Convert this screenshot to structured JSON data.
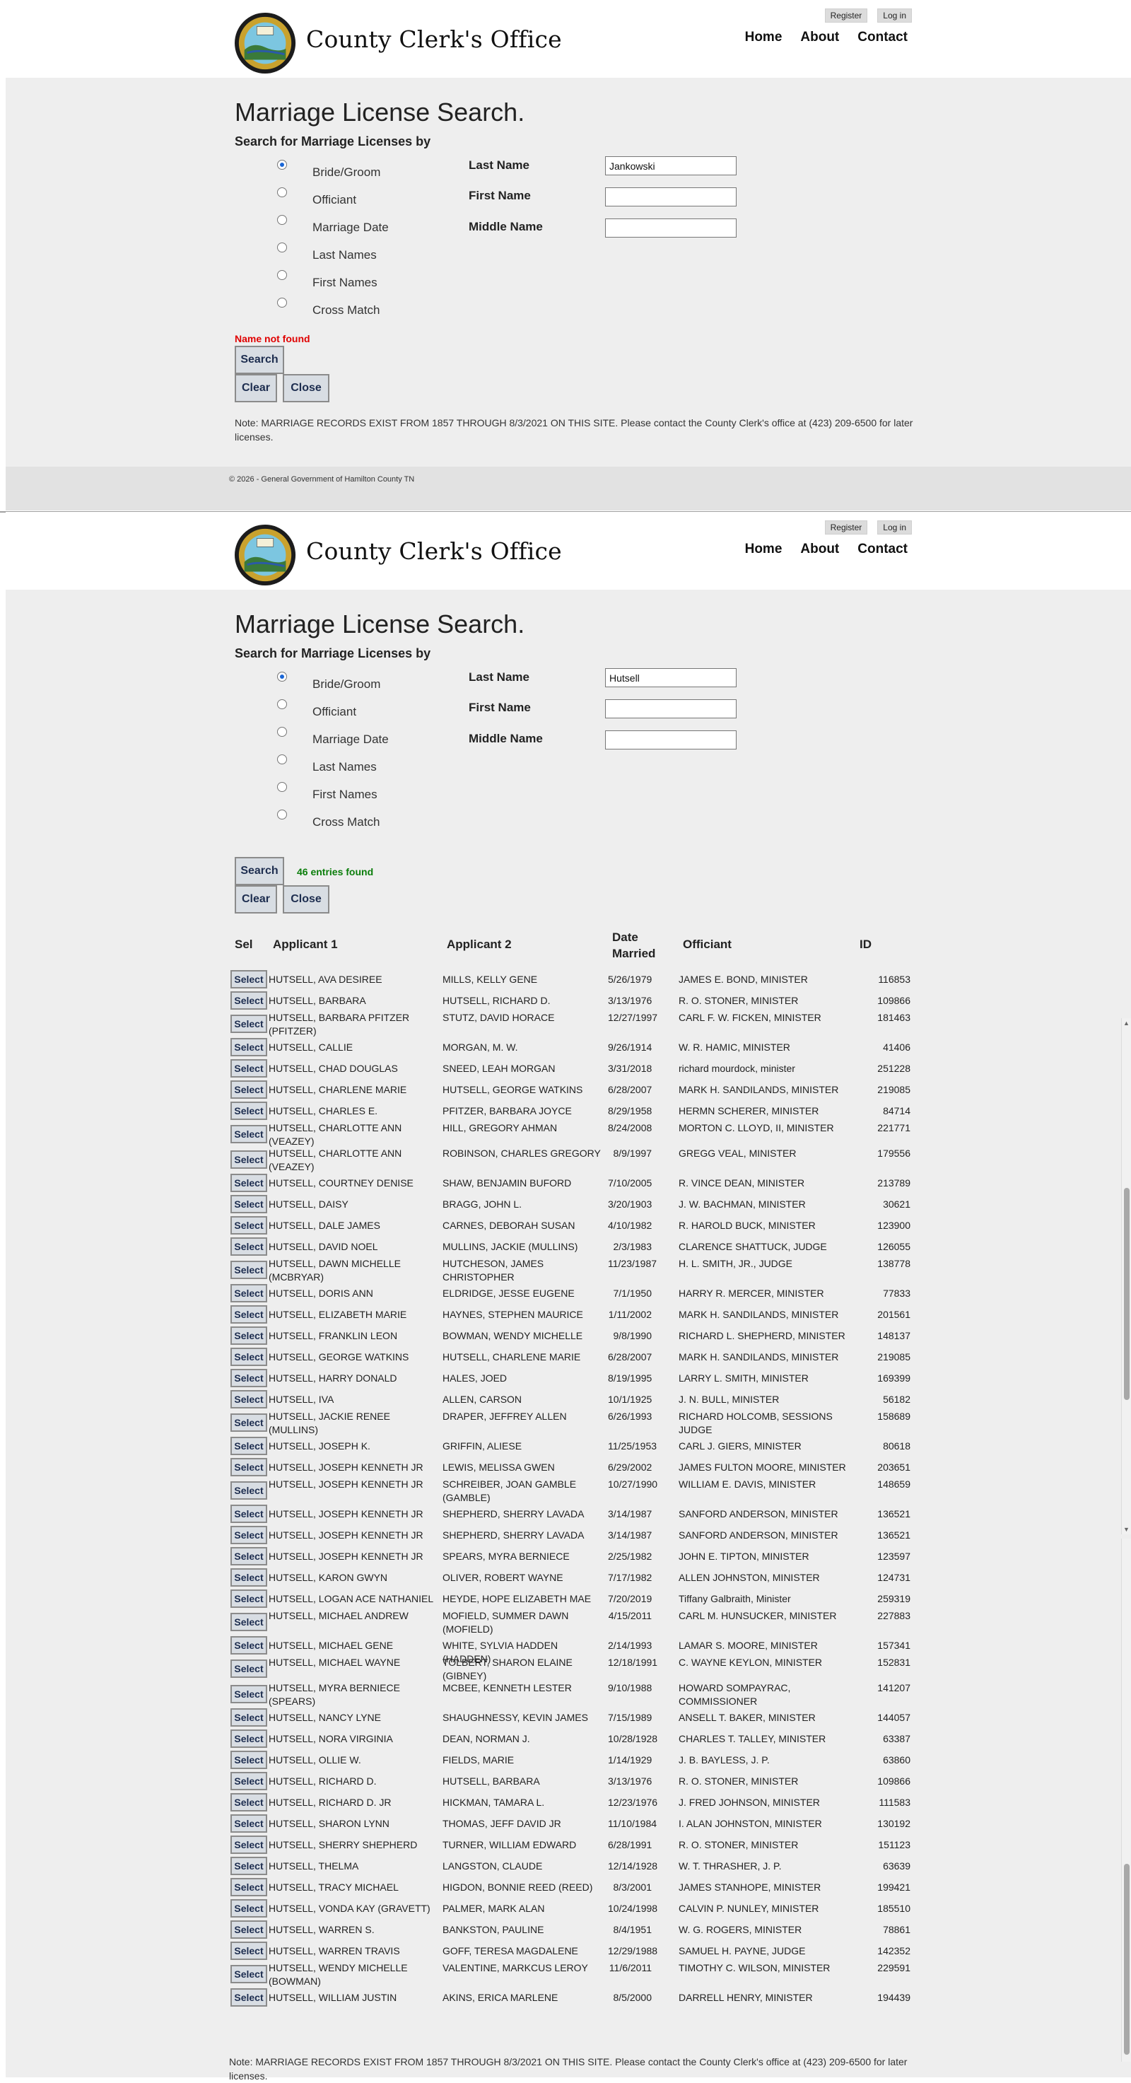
{
  "site": {
    "title": "County Clerk's Office",
    "mini_links": [
      "Register",
      "Log in"
    ],
    "nav": [
      "Home",
      "About",
      "Contact"
    ],
    "seal": {
      "top": "HAMILTON COUNTY",
      "center": "SEAL",
      "bottom": "TENNESSEE"
    }
  },
  "search_panel_1": {
    "heading": "Marriage License Search.",
    "subheading": "Search for Marriage Licenses by",
    "radios": [
      {
        "label": "Bride/Groom",
        "checked": true
      },
      {
        "label": "Officiant",
        "checked": false
      },
      {
        "label": "Marriage Date",
        "checked": false
      },
      {
        "label": "Last Names",
        "checked": false
      },
      {
        "label": "First Names",
        "checked": false
      },
      {
        "label": "Cross Match",
        "checked": false
      }
    ],
    "fields": [
      {
        "label": "Last Name",
        "value": "Jankowski"
      },
      {
        "label": "First Name",
        "value": ""
      },
      {
        "label": "Middle Name",
        "value": ""
      }
    ],
    "message": "Name not found",
    "search_label": "Search",
    "clear_label": "Clear",
    "close_label": "Close",
    "note": "Note: MARRIAGE RECORDS EXIST FROM 1857 THROUGH 8/3/2021 ON THIS SITE.  Please contact the County Clerk's office at (423) 209-6500 for later licenses.",
    "footer": "© 2026 - General Government of Hamilton County TN"
  },
  "search_panel_2": {
    "heading": "Marriage License Search.",
    "subheading": "Search for Marriage Licenses by",
    "radios": [
      {
        "label": "Bride/Groom",
        "checked": true
      },
      {
        "label": "Officiant",
        "checked": false
      },
      {
        "label": "Marriage Date",
        "checked": false
      },
      {
        "label": "Last Names",
        "checked": false
      },
      {
        "label": "First Names",
        "checked": false
      },
      {
        "label": "Cross Match",
        "checked": false
      }
    ],
    "fields": [
      {
        "label": "Last Name",
        "value": "Hutsell"
      },
      {
        "label": "First Name",
        "value": ""
      },
      {
        "label": "Middle Name",
        "value": ""
      }
    ],
    "message": "46 entries found",
    "search_label": "Search",
    "clear_label": "Clear",
    "close_label": "Close",
    "note": "Note: MARRIAGE RECORDS EXIST FROM 1857 THROUGH 8/3/2021 ON THIS SITE.  Please contact the County Clerk's office at (423) 209-6500 for later licenses."
  },
  "results": {
    "headers": [
      "Sel",
      "Applicant 1",
      "Applicant 2",
      "Date Married",
      "Officiant",
      "ID"
    ],
    "select_label": "Select",
    "rows": [
      [
        "HUTSELL, AVA DESIREE",
        "MILLS, KELLY GENE",
        "5/26/1979",
        "JAMES E. BOND, MINISTER",
        "116853"
      ],
      [
        "HUTSELL, BARBARA",
        "HUTSELL, RICHARD D.",
        "3/13/1976",
        "R. O. STONER, MINISTER",
        "109866"
      ],
      [
        "HUTSELL, BARBARA PFITZER (PFITZER)",
        "STUTZ, DAVID HORACE",
        "12/27/1997",
        "CARL F. W. FICKEN, MINISTER",
        "181463"
      ],
      [
        "HUTSELL, CALLIE",
        "MORGAN, M. W.",
        "9/26/1914",
        "W. R. HAMIC, MINISTER",
        "41406"
      ],
      [
        "HUTSELL, CHAD DOUGLAS",
        "SNEED, LEAH MORGAN",
        "3/31/2018",
        "richard mourdock, minister",
        "251228"
      ],
      [
        "HUTSELL, CHARLENE MARIE",
        "HUTSELL, GEORGE WATKINS",
        "6/28/2007",
        "MARK H. SANDILANDS, MINISTER",
        "219085"
      ],
      [
        "HUTSELL, CHARLES E.",
        "PFITZER, BARBARA JOYCE",
        "8/29/1958",
        "HERMN SCHERER, MINISTER",
        "84714"
      ],
      [
        "HUTSELL, CHARLOTTE ANN (VEAZEY)",
        "HILL, GREGORY AHMAN",
        "8/24/2008",
        "MORTON C. LLOYD, II, MINISTER",
        "221771"
      ],
      [
        "HUTSELL, CHARLOTTE ANN (VEAZEY)",
        "ROBINSON, CHARLES GREGORY",
        "8/9/1997",
        "GREGG VEAL, MINISTER",
        "179556"
      ],
      [
        "HUTSELL, COURTNEY DENISE",
        "SHAW, BENJAMIN BUFORD",
        "7/10/2005",
        "R. VINCE DEAN, MINISTER",
        "213789"
      ],
      [
        "HUTSELL, DAISY",
        "BRAGG, JOHN L.",
        "3/20/1903",
        "J. W. BACHMAN, MINISTER",
        "30621"
      ],
      [
        "HUTSELL, DALE JAMES",
        "CARNES, DEBORAH SUSAN",
        "4/10/1982",
        "R. HAROLD BUCK, MINISTER",
        "123900"
      ],
      [
        "HUTSELL, DAVID NOEL",
        "MULLINS, JACKIE (MULLINS)",
        "2/3/1983",
        "CLARENCE SHATTUCK, JUDGE",
        "126055"
      ],
      [
        "HUTSELL, DAWN MICHELLE (MCBRYAR)",
        "HUTCHESON, JAMES CHRISTOPHER",
        "11/23/1987",
        "H. L. SMITH, JR., JUDGE",
        "138778"
      ],
      [
        "HUTSELL, DORIS ANN",
        "ELDRIDGE, JESSE EUGENE",
        "7/1/1950",
        "HARRY R. MERCER, MINISTER",
        "77833"
      ],
      [
        "HUTSELL, ELIZABETH MARIE",
        "HAYNES, STEPHEN MAURICE",
        "1/11/2002",
        "MARK H. SANDILANDS, MINISTER",
        "201561"
      ],
      [
        "HUTSELL, FRANKLIN LEON",
        "BOWMAN, WENDY MICHELLE",
        "9/8/1990",
        "RICHARD L. SHEPHERD, MINISTER",
        "148137"
      ],
      [
        "HUTSELL, GEORGE WATKINS",
        "HUTSELL, CHARLENE MARIE",
        "6/28/2007",
        "MARK H. SANDILANDS, MINISTER",
        "219085"
      ],
      [
        "HUTSELL, HARRY DONALD",
        "HALES, JOED",
        "8/19/1995",
        "LARRY L. SMITH, MINISTER",
        "169399"
      ],
      [
        "HUTSELL, IVA",
        "ALLEN, CARSON",
        "10/1/1925",
        "J. N. BULL, MINISTER",
        "56182"
      ],
      [
        "HUTSELL, JACKIE RENEE (MULLINS)",
        "DRAPER, JEFFREY ALLEN",
        "6/26/1993",
        "RICHARD HOLCOMB, SESSIONS JUDGE",
        "158689"
      ],
      [
        "HUTSELL, JOSEPH K.",
        "GRIFFIN, ALIESE",
        "11/25/1953",
        "CARL J. GIERS, MINISTER",
        "80618"
      ],
      [
        "HUTSELL, JOSEPH KENNETH JR",
        "LEWIS, MELISSA GWEN",
        "6/29/2002",
        "JAMES FULTON MOORE, MINISTER",
        "203651"
      ],
      [
        "HUTSELL, JOSEPH KENNETH JR",
        "SCHREIBER, JOAN GAMBLE (GAMBLE)",
        "10/27/1990",
        "WILLIAM E. DAVIS, MINISTER",
        "148659"
      ],
      [
        "HUTSELL, JOSEPH KENNETH JR",
        "SHEPHERD, SHERRY LAVADA",
        "3/14/1987",
        "SANFORD ANDERSON, MINISTER",
        "136521"
      ],
      [
        "HUTSELL, JOSEPH KENNETH JR",
        "SHEPHERD, SHERRY LAVADA",
        "3/14/1987",
        "SANFORD ANDERSON, MINISTER",
        "136521"
      ],
      [
        "HUTSELL, JOSEPH KENNETH JR",
        "SPEARS, MYRA BERNIECE",
        "2/25/1982",
        "JOHN E. TIPTON, MINISTER",
        "123597"
      ],
      [
        "HUTSELL, KARON GWYN",
        "OLIVER, ROBERT WAYNE",
        "7/17/1982",
        "ALLEN JOHNSTON, MINISTER",
        "124731"
      ],
      [
        "HUTSELL, LOGAN ACE NATHANIEL",
        "HEYDE, HOPE ELIZABETH MAE",
        "7/20/2019",
        "Tiffany Galbraith, Minister",
        "259319"
      ],
      [
        "HUTSELL, MICHAEL ANDREW",
        "MOFIELD, SUMMER DAWN (MOFIELD)",
        "4/15/2011",
        "CARL M. HUNSUCKER, MINISTER",
        "227883"
      ],
      [
        "HUTSELL, MICHAEL GENE",
        "WHITE, SYLVIA HADDEN (HADDEN)",
        "2/14/1993",
        "LAMAR S. MOORE, MINISTER",
        "157341"
      ],
      [
        "HUTSELL, MICHAEL WAYNE",
        "TOLBERT, SHARON ELAINE (GIBNEY)",
        "12/18/1991",
        "C. WAYNE KEYLON, MINISTER",
        "152831"
      ],
      [
        "HUTSELL, MYRA BERNIECE (SPEARS)",
        "MCBEE, KENNETH LESTER",
        "9/10/1988",
        "HOWARD SOMPAYRAC, COMMISSIONER",
        "141207"
      ],
      [
        "HUTSELL, NANCY LYNE",
        "SHAUGHNESSY, KEVIN JAMES",
        "7/15/1989",
        "ANSELL T. BAKER, MINISTER",
        "144057"
      ],
      [
        "HUTSELL, NORA VIRGINIA",
        "DEAN, NORMAN J.",
        "10/28/1928",
        "CHARLES T. TALLEY, MINISTER",
        "63387"
      ],
      [
        "HUTSELL, OLLIE W.",
        "FIELDS, MARIE",
        "1/14/1929",
        "J. B. BAYLESS, J. P.",
        "63860"
      ],
      [
        "HUTSELL, RICHARD D.",
        "HUTSELL, BARBARA",
        "3/13/1976",
        "R. O. STONER, MINISTER",
        "109866"
      ],
      [
        "HUTSELL, RICHARD D. JR",
        "HICKMAN, TAMARA L.",
        "12/23/1976",
        "J. FRED JOHNSON, MINISTER",
        "111583"
      ],
      [
        "HUTSELL, SHARON LYNN",
        "THOMAS, JEFF DAVID JR",
        "11/10/1984",
        "I. ALAN JOHNSTON, MINISTER",
        "130192"
      ],
      [
        "HUTSELL, SHERRY SHEPHERD",
        "TURNER, WILLIAM EDWARD",
        "6/28/1991",
        "R. O. STONER, MINISTER",
        "151123"
      ],
      [
        "HUTSELL, THELMA",
        "LANGSTON, CLAUDE",
        "12/14/1928",
        "W. T. THRASHER, J. P.",
        "63639"
      ],
      [
        "HUTSELL, TRACY MICHAEL",
        "HIGDON, BONNIE REED (REED)",
        "8/3/2001",
        "JAMES STANHOPE, MINISTER",
        "199421"
      ],
      [
        "HUTSELL, VONDA KAY (GRAVETT)",
        "PALMER, MARK ALAN",
        "10/24/1998",
        "CALVIN P. NUNLEY, MINISTER",
        "185510"
      ],
      [
        "HUTSELL, WARREN S.",
        "BANKSTON, PAULINE",
        "8/4/1951",
        "W. G. ROGERS, MINISTER",
        "78861"
      ],
      [
        "HUTSELL, WARREN TRAVIS",
        "GOFF, TERESA MAGDALENE",
        "12/29/1988",
        "SAMUEL H. PAYNE, JUDGE",
        "142352"
      ],
      [
        "HUTSELL, WENDY MICHELLE (BOWMAN)",
        "VALENTINE, MARKCUS LEROY",
        "11/6/2011",
        "TIMOTHY C. WILSON, MINISTER",
        "229591"
      ],
      [
        "HUTSELL, WILLIAM JUSTIN",
        "AKINS, ERICA MARLENE",
        "8/5/2000",
        "DARRELL HENRY, MINISTER",
        "194439"
      ]
    ]
  },
  "colors": {
    "error": "#e00000",
    "success": "#0a7d0a",
    "panel_bg": "#eeeeee",
    "button_bg": "#d8dde3"
  }
}
